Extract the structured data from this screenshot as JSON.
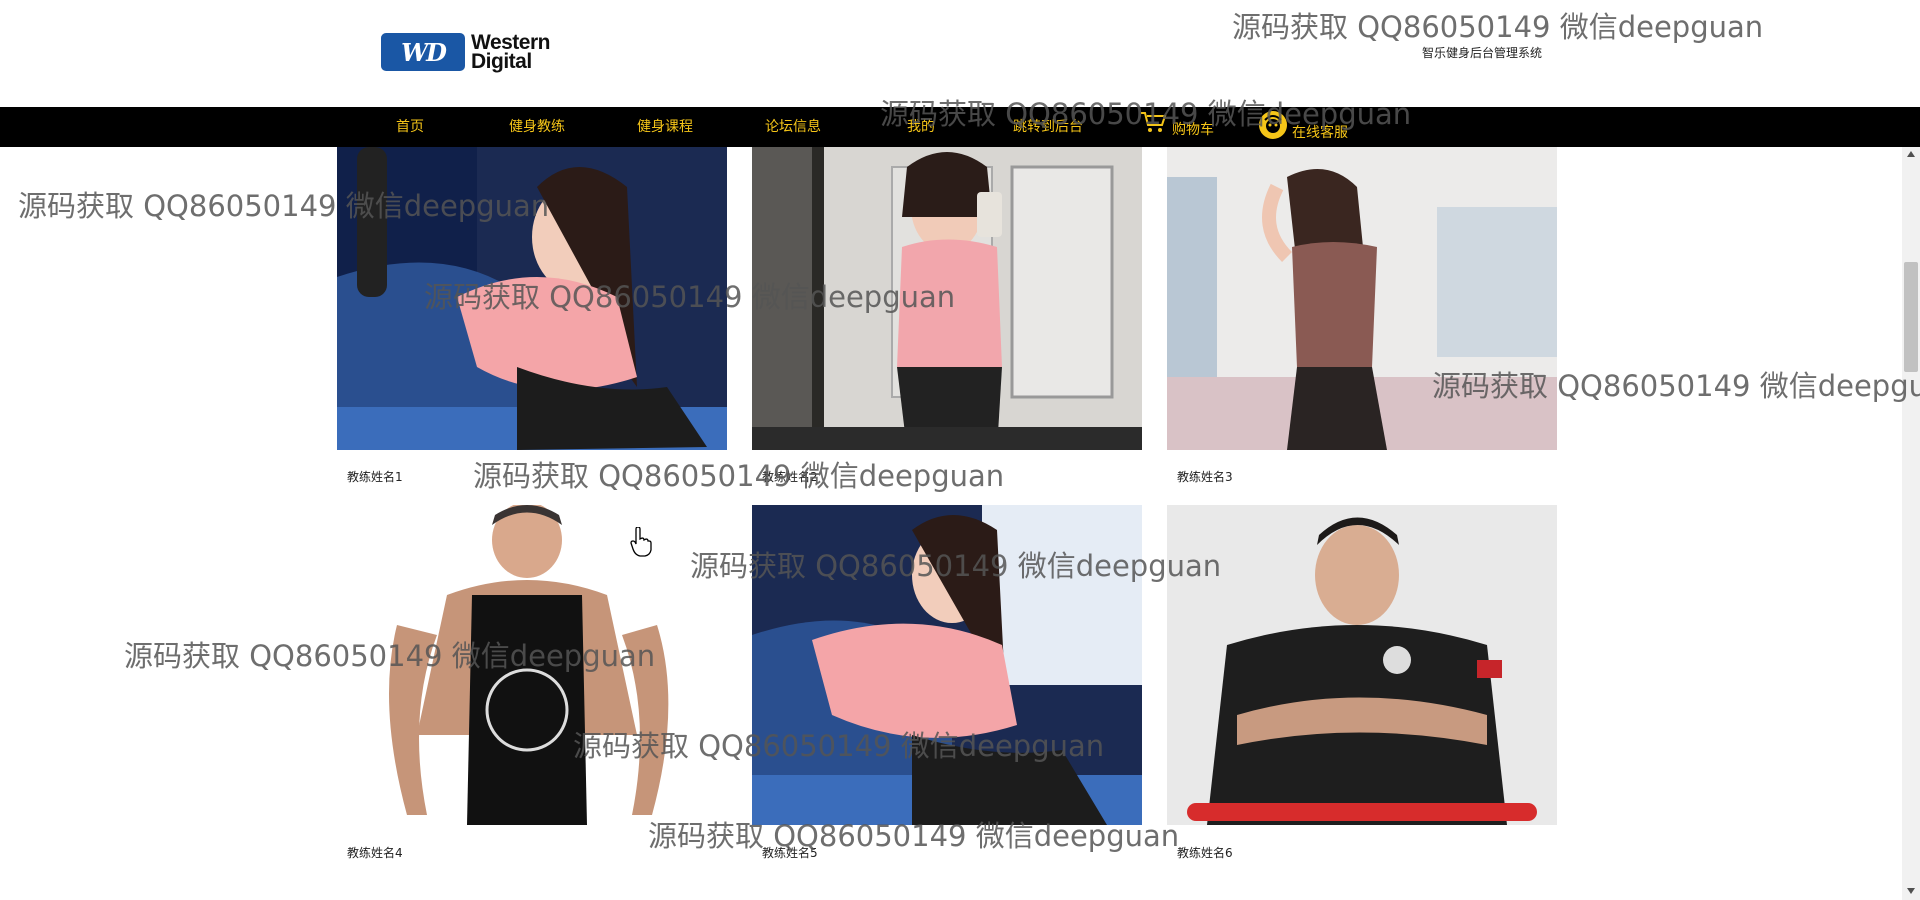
{
  "header": {
    "logo_line1": "Western",
    "logo_line2": "Digital",
    "logo_mark": "WD",
    "system_title": "智乐健身后台管理系统"
  },
  "nav": {
    "items": [
      {
        "label": "首页"
      },
      {
        "label": "健身教练"
      },
      {
        "label": "健身课程"
      },
      {
        "label": "论坛信息"
      },
      {
        "label": "我的"
      },
      {
        "label": "跳转到后台"
      },
      {
        "label": "购物车",
        "icon": "cart-icon"
      },
      {
        "label": "在线客服",
        "icon": "customer-service-icon"
      }
    ],
    "color": "#f5c518",
    "background": "#000000"
  },
  "coaches": [
    {
      "name": "教练姓名1"
    },
    {
      "name": "教练姓名2"
    },
    {
      "name": "教练姓名3"
    },
    {
      "name": "教练姓名4"
    },
    {
      "name": "教练姓名5"
    },
    {
      "name": "教练姓名6"
    }
  ],
  "watermark": {
    "text": "源码获取 QQ86050149 微信deepguan"
  },
  "colors": {
    "brand_blue": "#1a57a5",
    "nav_text": "#f5c518"
  }
}
